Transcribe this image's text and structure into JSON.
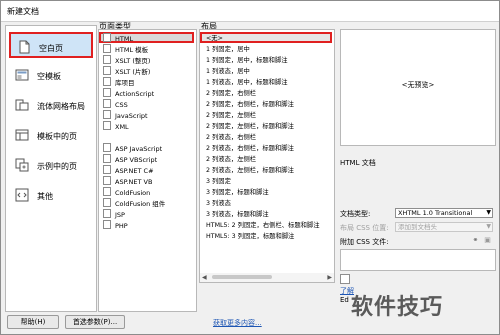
{
  "window": {
    "title": "新建文档"
  },
  "categories": [
    {
      "label": "空白页",
      "icon": "blank-page-icon",
      "selected": true
    },
    {
      "label": "空模板",
      "icon": "blank-template-icon"
    },
    {
      "label": "流体网格布局",
      "icon": "fluid-grid-icon"
    },
    {
      "label": "模板中的页",
      "icon": "template-page-icon"
    },
    {
      "label": "示例中的页",
      "icon": "sample-page-icon"
    },
    {
      "label": "其他",
      "icon": "other-icon"
    }
  ],
  "page_types": {
    "header": "页面类型",
    "items": [
      "HTML",
      "HTML 模板",
      "XSLT (整页)",
      "XSLT (片断)",
      "库项目",
      "ActionScript",
      "CSS",
      "JavaScript",
      "XML",
      "",
      "ASP JavaScript",
      "ASP VBScript",
      "ASP.NET C#",
      "ASP.NET VB",
      "ColdFusion",
      "ColdFusion 组件",
      "JSP",
      "PHP"
    ],
    "selected": "HTML"
  },
  "layouts": {
    "header": "布局",
    "items": [
      "<无>",
      "1 列固定，居中",
      "1 列固定，居中，标题和脚注",
      "1 列液态，居中",
      "1 列液态，居中，标题和脚注",
      "2 列固定，右侧栏",
      "2 列固定，右侧栏，标题和脚注",
      "2 列固定，左侧栏",
      "2 列固定，左侧栏，标题和脚注",
      "2 列液态，右侧栏",
      "2 列液态，右侧栏，标题和脚注",
      "2 列液态，左侧栏",
      "2 列液态，左侧栏，标题和脚注",
      "3 列固定",
      "3 列固定，标题和脚注",
      "3 列液态",
      "3 列液态，标题和脚注",
      "HTML5: 2 列固定，右侧栏、标题和脚注",
      "HTML5: 3 列固定，标题和脚注"
    ],
    "selected": "<无>"
  },
  "preview": {
    "placeholder": "<无预览>",
    "description": "HTML 文档"
  },
  "options": {
    "doctype_label": "文档类型:",
    "doctype_value": "XHTML 1.0 Transitional",
    "layout_css_label": "布局 CSS 位置:",
    "layout_css_value": "添加到文档头",
    "attach_css_label": "附加 CSS 文件:",
    "learn_more": "了解",
    "partial_label": "Ed"
  },
  "footer": {
    "help_label": "帮助(H)",
    "prefs_label": "首选参数(P)...",
    "more_content_link": "获取更多内容..."
  },
  "watermark": "软件技巧"
}
